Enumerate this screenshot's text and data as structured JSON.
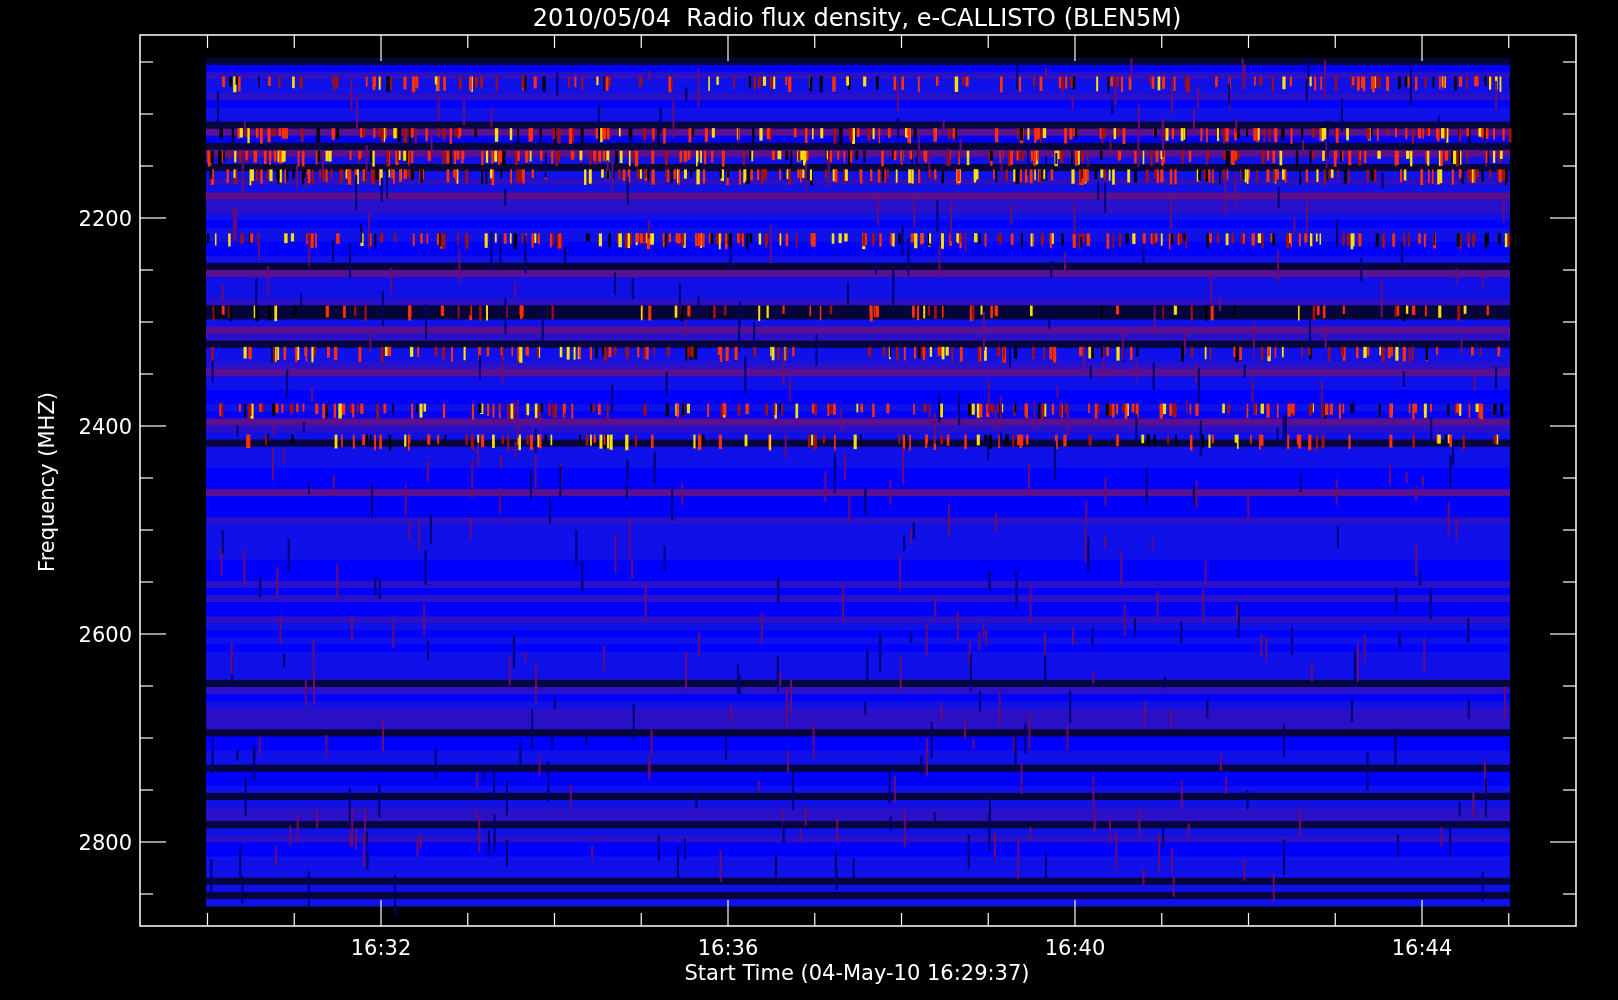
{
  "plot": {
    "title": "2010/05/04  Radio flux density, e-CALLISTO (BLEN5M)",
    "ylabel": "Frequency (MHZ)",
    "xlabel": "Start Time (04-May-10 16:29:37)",
    "yticks": [
      "2200",
      "2400",
      "2600",
      "2800"
    ],
    "xticks": [
      "16:32",
      "16:36",
      "16:40",
      "16:44"
    ]
  }
}
